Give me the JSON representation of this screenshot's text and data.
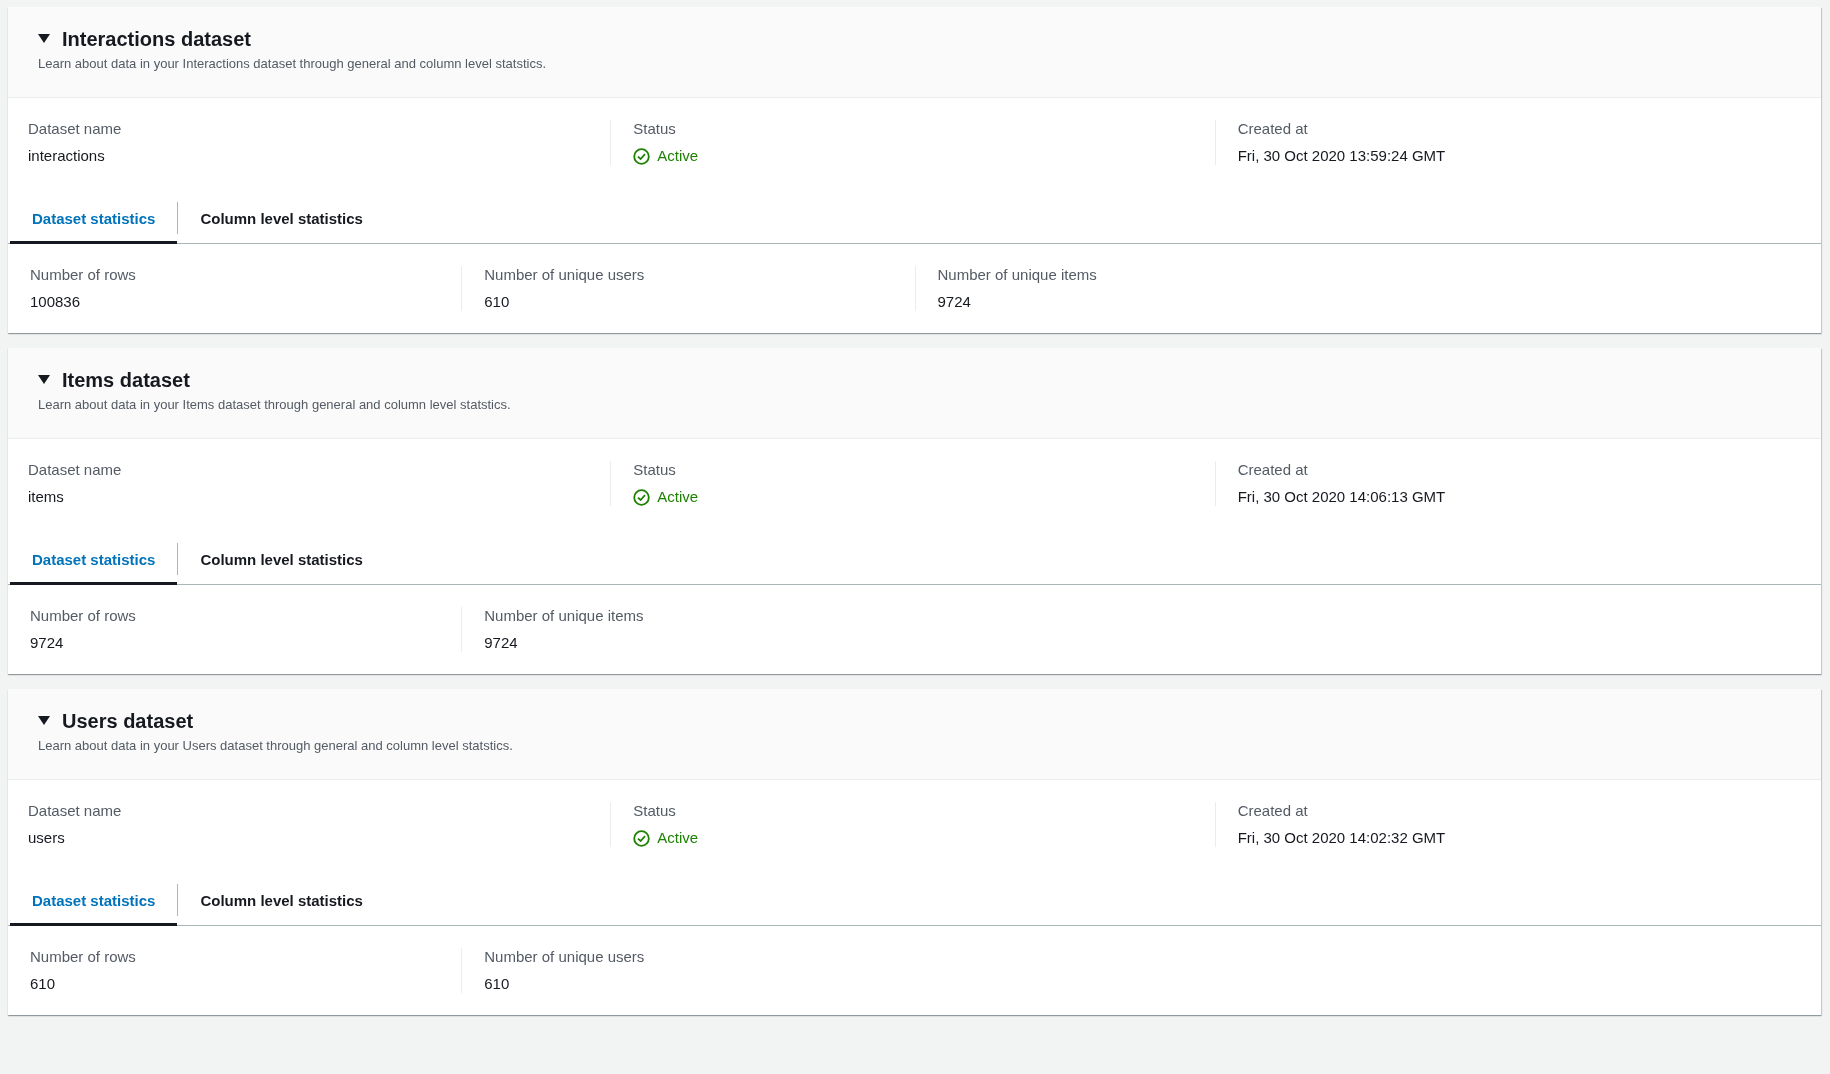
{
  "panels": [
    {
      "title": "Interactions dataset",
      "expanded": true,
      "description": "Learn about data in your Interactions dataset through general and column level statstics.",
      "summary": [
        {
          "label": "Dataset name",
          "value": "interactions"
        },
        {
          "label": "Status",
          "value": "Active",
          "kind": "status"
        },
        {
          "label": "Created at",
          "value": "Fri, 30 Oct 2020 13:59:24 GMT"
        }
      ],
      "tabs": [
        {
          "label": "Dataset statistics",
          "selected": true
        },
        {
          "label": "Column level statistics",
          "selected": false
        }
      ],
      "stats": [
        {
          "label": "Number of rows",
          "value": "100836"
        },
        {
          "label": "Number of unique users",
          "value": "610"
        },
        {
          "label": "Number of unique items",
          "value": "9724"
        }
      ]
    },
    {
      "title": "Items dataset",
      "expanded": true,
      "description": "Learn about data in your Items dataset through general and column level statstics.",
      "summary": [
        {
          "label": "Dataset name",
          "value": "items"
        },
        {
          "label": "Status",
          "value": "Active",
          "kind": "status"
        },
        {
          "label": "Created at",
          "value": "Fri, 30 Oct 2020 14:06:13 GMT"
        }
      ],
      "tabs": [
        {
          "label": "Dataset statistics",
          "selected": true
        },
        {
          "label": "Column level statistics",
          "selected": false
        }
      ],
      "stats": [
        {
          "label": "Number of rows",
          "value": "9724"
        },
        {
          "label": "Number of unique items",
          "value": "9724"
        }
      ]
    },
    {
      "title": "Users dataset",
      "expanded": true,
      "description": "Learn about data in your Users dataset through general and column level statstics.",
      "summary": [
        {
          "label": "Dataset name",
          "value": "users"
        },
        {
          "label": "Status",
          "value": "Active",
          "kind": "status"
        },
        {
          "label": "Created at",
          "value": "Fri, 30 Oct 2020 14:02:32 GMT"
        }
      ],
      "tabs": [
        {
          "label": "Dataset statistics",
          "selected": true
        },
        {
          "label": "Column level statistics",
          "selected": false
        }
      ],
      "stats": [
        {
          "label": "Number of rows",
          "value": "610"
        },
        {
          "label": "Number of unique users",
          "value": "610"
        }
      ]
    }
  ]
}
